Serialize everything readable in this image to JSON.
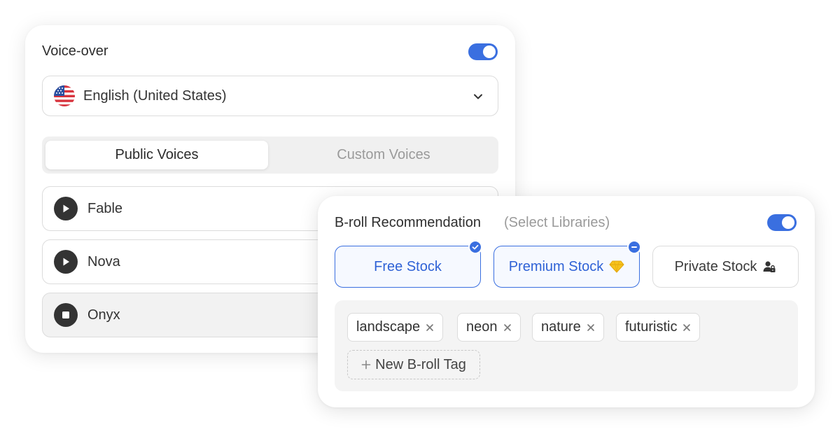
{
  "voice_over": {
    "title": "Voice-over",
    "enabled": true,
    "language": {
      "selected": "English (United States)",
      "flag_icon": "us-flag-icon"
    },
    "tabs": [
      {
        "label": "Public Voices",
        "active": true
      },
      {
        "label": "Custom Voices",
        "active": false
      }
    ],
    "voices": [
      {
        "name": "Fable",
        "state": "play"
      },
      {
        "name": "Nova",
        "state": "play"
      },
      {
        "name": "Onyx",
        "state": "stop"
      }
    ]
  },
  "broll": {
    "title": "B-roll Recommendation",
    "subtitle": "(Select Libraries)",
    "enabled": true,
    "libraries": [
      {
        "label": "Free Stock",
        "selected": true,
        "badge": "check-icon"
      },
      {
        "label": "Premium Stock",
        "selected": true,
        "badge": "minus-icon",
        "icon": "diamond-icon"
      },
      {
        "label": "Private Stock",
        "selected": false,
        "icon": "private-user-icon"
      }
    ],
    "tags": [
      "landscape",
      "neon",
      "nature",
      "futuristic"
    ],
    "new_tag_label": "New B-roll Tag"
  },
  "colors": {
    "accent": "#3a6fe0",
    "selected_text": "#2f62d6",
    "muted_text": "#9a9a9a",
    "border": "#dcdcdc"
  }
}
